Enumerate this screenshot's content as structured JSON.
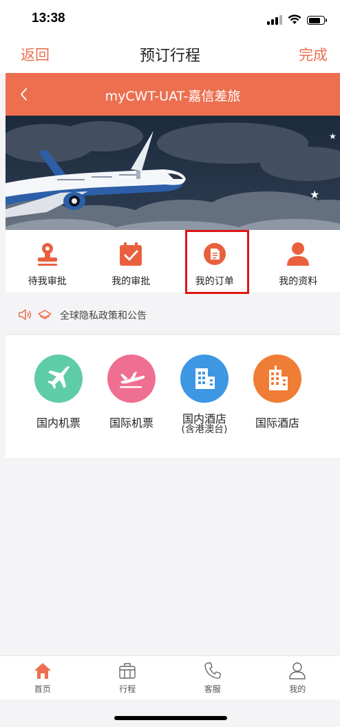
{
  "status_bar": {
    "time": "13:38"
  },
  "nav": {
    "back_label": "返回",
    "title": "预订行程",
    "done_label": "完成"
  },
  "app_header": {
    "title": "myCWT-UAT-嘉信差旅"
  },
  "quick_actions": [
    {
      "label": "待我审批",
      "icon": "stamp-icon"
    },
    {
      "label": "我的审批",
      "icon": "calendar-check-icon"
    },
    {
      "label": "我的订单",
      "icon": "document-icon"
    },
    {
      "label": "我的资料",
      "icon": "person-icon"
    }
  ],
  "notice": {
    "text": "全球隐私政策和公告"
  },
  "services": [
    {
      "label": "国内机票",
      "sub": "",
      "icon": "plane-icon",
      "color": "#5fcca8"
    },
    {
      "label": "国际机票",
      "sub": "",
      "icon": "plane-departure-icon",
      "color": "#ef6f92"
    },
    {
      "label": "国内酒店",
      "sub": "(含港澳台)",
      "icon": "building-icon",
      "color": "#3d97e3"
    },
    {
      "label": "国际酒店",
      "sub": "",
      "icon": "hotel-icon",
      "color": "#f07d35"
    }
  ],
  "tabs": [
    {
      "label": "首页",
      "icon": "home-icon"
    },
    {
      "label": "行程",
      "icon": "luggage-icon"
    },
    {
      "label": "客服",
      "icon": "phone-icon"
    },
    {
      "label": "我的",
      "icon": "user-icon"
    }
  ],
  "colors": {
    "accent": "#ec6f50",
    "highlight": "#e01515"
  }
}
